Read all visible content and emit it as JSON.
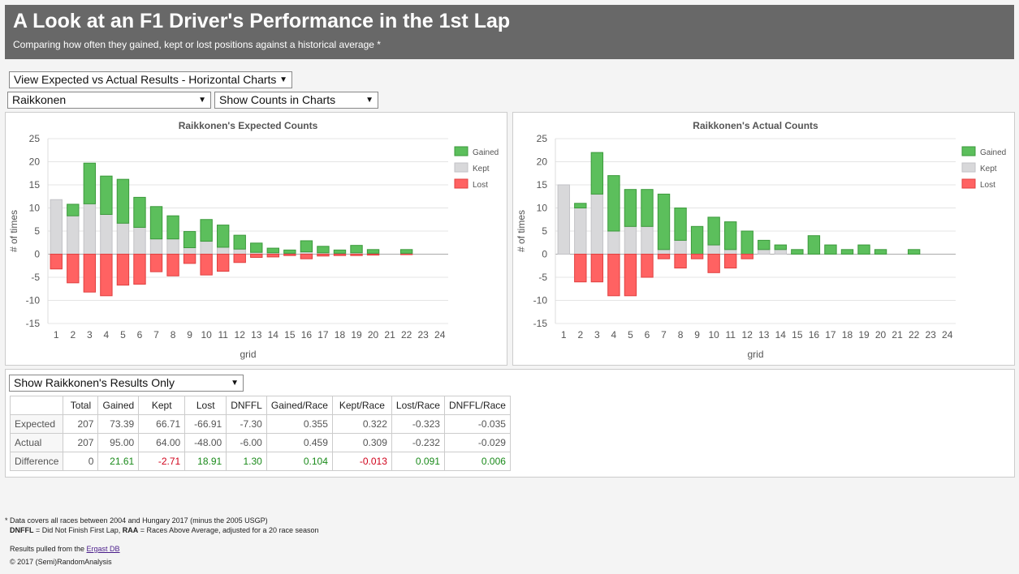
{
  "header": {
    "title": "A Look at an F1 Driver's Performance in the 1st Lap",
    "subtitle": "Comparing how often they gained, kept or lost positions against a historical average *"
  },
  "controls": {
    "view_select": "View Expected vs Actual Results - Horizontal Charts",
    "driver_select": "Raikkonen",
    "mode_select": "Show Counts in Charts",
    "results_select": "Show Raikkonen's Results Only"
  },
  "colors": {
    "gained": "#5cbf5c",
    "kept": "#d8d8da",
    "lost": "#ff6262"
  },
  "chart_data": [
    {
      "type": "bar",
      "stacked": true,
      "title": "Raikkonen's Expected Counts",
      "xlabel": "grid",
      "ylabel": "# of times",
      "ylim": [
        -15,
        25
      ],
      "yticks": [
        25,
        20,
        15,
        10,
        5,
        0,
        -5,
        -10,
        -15
      ],
      "grid": true,
      "legend_position": "top-right",
      "categories": [
        "1",
        "2",
        "3",
        "4",
        "5",
        "6",
        "7",
        "8",
        "9",
        "10",
        "11",
        "12",
        "13",
        "14",
        "15",
        "16",
        "17",
        "18",
        "19",
        "20",
        "21",
        "22",
        "23",
        "24"
      ],
      "series": [
        {
          "name": "Gained",
          "values": [
            0,
            2.5,
            8.8,
            8.3,
            9.5,
            6.5,
            7,
            5,
            3.5,
            4.7,
            4.8,
            3,
            2,
            1,
            0.7,
            2.4,
            1.4,
            0.7,
            1.6,
            0.8,
            0,
            0.8,
            0,
            0
          ]
        },
        {
          "name": "Kept",
          "values": [
            11.8,
            8.3,
            10.9,
            8.6,
            6.7,
            5.8,
            3.3,
            3.3,
            1.4,
            2.8,
            1.5,
            1.1,
            0.4,
            0.3,
            0.2,
            0.5,
            0.3,
            0.2,
            0.3,
            0.2,
            0,
            0.2,
            0,
            0
          ]
        },
        {
          "name": "Lost",
          "values": [
            -3.2,
            -6.2,
            -8.2,
            -9,
            -6.7,
            -6.5,
            -3.8,
            -4.7,
            -2,
            -4.5,
            -3.7,
            -1.8,
            -0.7,
            -0.6,
            -0.3,
            -1,
            -0.4,
            -0.3,
            -0.3,
            -0.2,
            0,
            -0.1,
            0,
            0
          ]
        }
      ]
    },
    {
      "type": "bar",
      "stacked": true,
      "title": "Raikkonen's Actual Counts",
      "xlabel": "grid",
      "ylabel": "# of times",
      "ylim": [
        -15,
        25
      ],
      "yticks": [
        25,
        20,
        15,
        10,
        5,
        0,
        -5,
        -10,
        -15
      ],
      "grid": true,
      "legend_position": "top-right",
      "categories": [
        "1",
        "2",
        "3",
        "4",
        "5",
        "6",
        "7",
        "8",
        "9",
        "10",
        "11",
        "12",
        "13",
        "14",
        "15",
        "16",
        "17",
        "18",
        "19",
        "20",
        "21",
        "22",
        "23",
        "24"
      ],
      "series": [
        {
          "name": "Gained",
          "values": [
            0,
            1,
            9,
            12,
            8,
            8,
            12,
            7,
            6,
            6,
            6,
            5,
            2,
            1,
            1,
            4,
            2,
            1,
            2,
            1,
            0,
            1,
            0,
            0
          ]
        },
        {
          "name": "Kept",
          "values": [
            15,
            10,
            13,
            5,
            6,
            6,
            1,
            3,
            0,
            2,
            1,
            0,
            1,
            1,
            0,
            0,
            0,
            0,
            0,
            0,
            0,
            0,
            0,
            0
          ]
        },
        {
          "name": "Lost",
          "values": [
            0,
            -6,
            -6,
            -9,
            -9,
            -5,
            -1,
            -3,
            -1,
            -4,
            -3,
            -1,
            0,
            0,
            0,
            0,
            0,
            0,
            0,
            0,
            0,
            0,
            0,
            0
          ]
        }
      ]
    }
  ],
  "results_table": {
    "headers": [
      "",
      "Total",
      "Gained",
      "Kept",
      "Lost",
      "DNFFL",
      "Gained/Race",
      "Kept/Race",
      "Lost/Race",
      "DNFFL/Race"
    ],
    "rows": [
      {
        "label": "Expected",
        "cells": [
          "207",
          "73.39",
          "66.71",
          "-66.91",
          "-7.30",
          "0.355",
          "0.322",
          "-0.323",
          "-0.035"
        ],
        "tone": [
          "",
          "",
          "",
          "",
          "",
          "",
          "",
          "",
          ""
        ]
      },
      {
        "label": "Actual",
        "cells": [
          "207",
          "95.00",
          "64.00",
          "-48.00",
          "-6.00",
          "0.459",
          "0.309",
          "-0.232",
          "-0.029"
        ],
        "tone": [
          "",
          "",
          "",
          "",
          "",
          "",
          "",
          "",
          ""
        ]
      },
      {
        "label": "Difference",
        "cells": [
          "0",
          "21.61",
          "-2.71",
          "18.91",
          "1.30",
          "0.104",
          "-0.013",
          "0.091",
          "0.006"
        ],
        "tone": [
          "",
          "pos",
          "neg",
          "pos",
          "pos",
          "pos",
          "neg",
          "pos",
          "pos"
        ]
      }
    ]
  },
  "footer": {
    "note1": "* Data covers all races between 2004 and Hungary 2017 (minus the 2005 USGP)",
    "dnffl_term": "DNFFL",
    "dnffl_def": " = Did Not Finish First Lap, ",
    "raa_term": "RAA",
    "raa_def": " = Races Above Average, adjusted for a 20 race season",
    "source_prefix": "Results pulled from the ",
    "source_link": "Ergast DB",
    "copyright": "© 2017 (Semi)RandomAnalysis"
  }
}
